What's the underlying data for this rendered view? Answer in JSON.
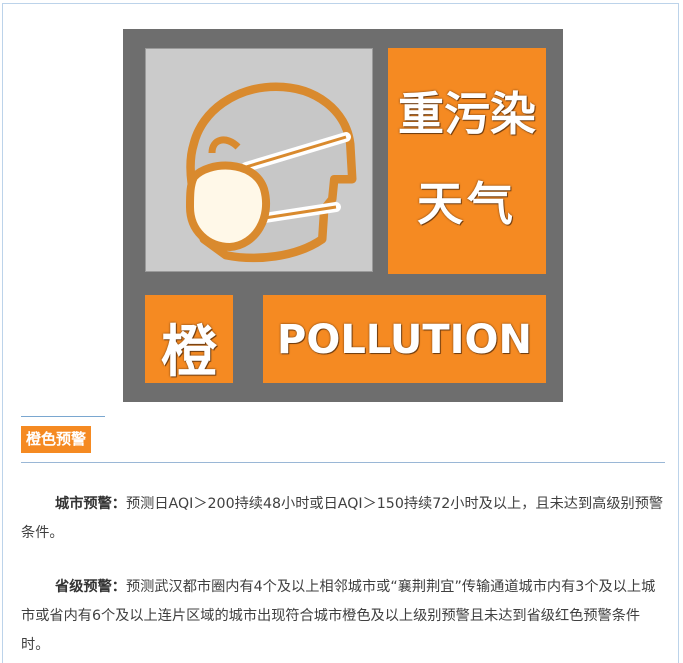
{
  "sign": {
    "title_line1": "重污染",
    "title_line2": "天气",
    "level": "橙",
    "english": "POLLUTION",
    "colors": {
      "orange": "#f58a22",
      "frame": "#6e6e6e",
      "pic_bg": "#cbcbcb"
    },
    "icon": "person-wearing-mask-icon"
  },
  "section": {
    "badge": "橙色预警"
  },
  "paragraphs": [
    {
      "label": "城市预警：",
      "text": "预测日AQI＞200持续48小时或日AQI＞150持续72小时及以上，且未达到高级别预警条件。"
    },
    {
      "label": "省级预警：",
      "text": "预测武汉都市圈内有4个及以上相邻城市或“襄荆荆宜”传输通道城市内有3个及以上城市或省内有6个及以上连片区域的城市出现符合城市橙色及以上级别预警且未达到省级红色预警条件时。"
    }
  ]
}
